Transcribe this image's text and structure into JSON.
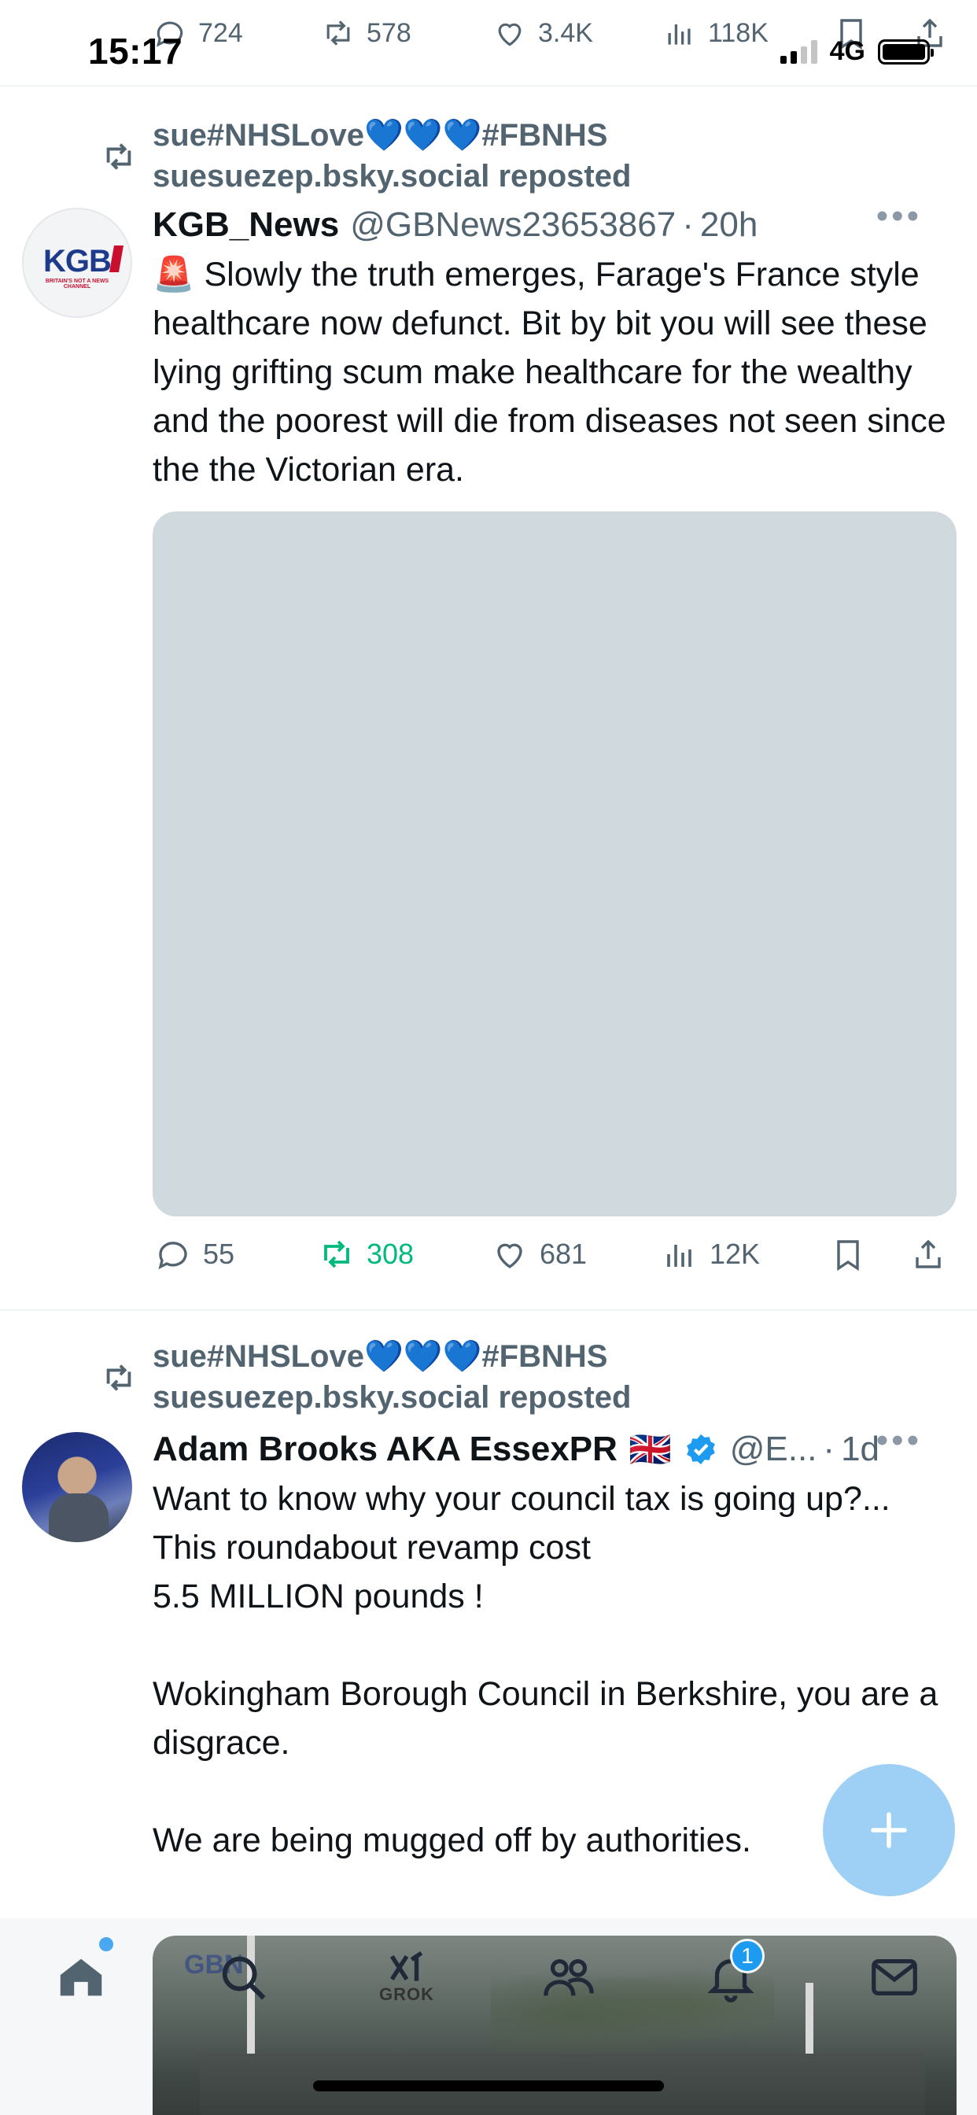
{
  "status_bar": {
    "time": "15:17",
    "network": "4G"
  },
  "ghost_actions": {
    "replies": "724",
    "reposts": "578",
    "likes": "3.4K",
    "views": "118K"
  },
  "posts": [
    {
      "repost_by": "sue#NHSLove💙💙💙#FBNHS",
      "repost_line2": "suesuezep.bsky.social reposted",
      "avatar_text": "KGB",
      "avatar_sub": "BRITAIN'S NOT A NEWS CHANNEL",
      "display_name": "KGB_News",
      "handle": "@GBNews23653867",
      "time": "20h",
      "text": "🚨 Slowly the truth emerges, Farage's France style healthcare now defunct. Bit by bit you will see these lying grifting scum make healthcare for the wealthy and the poorest will die from diseases not seen since the the Victorian era.",
      "actions": {
        "replies": "55",
        "reposts": "308",
        "likes": "681",
        "views": "12K"
      }
    },
    {
      "repost_by": "sue#NHSLove💙💙💙#FBNHS",
      "repost_line2": "suesuezep.bsky.social reposted",
      "display_name": "Adam Brooks AKA EssexPR",
      "flag": "🇬🇧",
      "handle": "@E...",
      "time": "1d",
      "text": "Want to know why your council tax is going up?...\nThis roundabout revamp cost\n5.5 MILLION pounds !\n\nWokingham Borough Council in Berkshire, you are a disgrace.\n\nWe are being mugged off by authorities."
    }
  ],
  "nav": {
    "grok_label": "GROK",
    "notifications_count": "1",
    "media_watermark": "GBN"
  },
  "colors": {
    "accent": "#1d9bf0",
    "repost_green": "#00ba7c",
    "muted": "#536471",
    "fab": "#9ed0f6"
  }
}
